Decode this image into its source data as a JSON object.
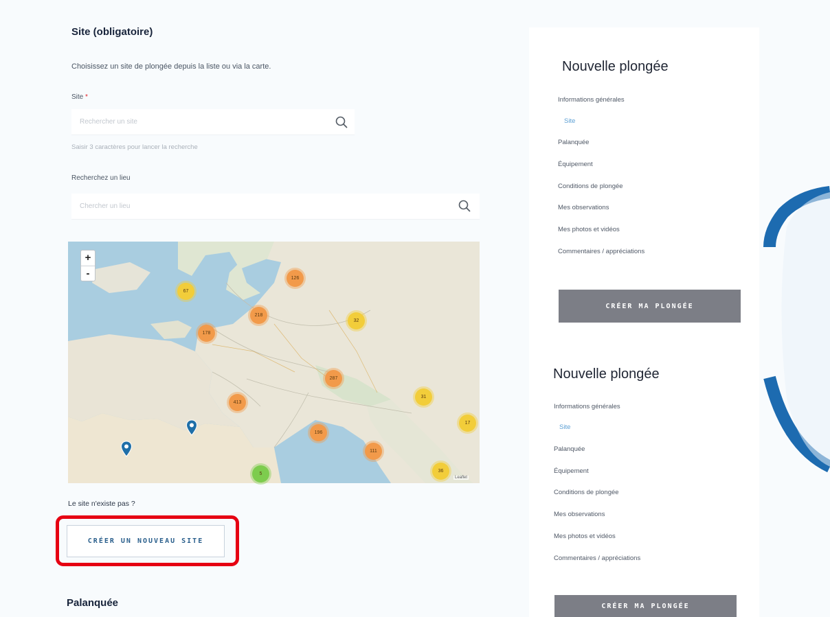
{
  "form": {
    "section_title": "Site (obligatoire)",
    "description": "Choisissez un site de plongée depuis la liste ou via la carte.",
    "site_label": "Site",
    "site_required_mark": "*",
    "site_input_placeholder": "Rechercher un site",
    "site_help": "Saisir 3 caractères pour lancer la recherche",
    "place_label": "Recherchez un lieu",
    "place_input_placeholder": "Chercher un lieu",
    "no_site_text": "Le site n'existe pas ?",
    "new_site_button": "CRÉER UN NOUVEAU SITE",
    "next_section_title": "Palanquée"
  },
  "map": {
    "zoom_in": "+",
    "zoom_out": "-",
    "attribution": "Leaflet",
    "clusters": [
      {
        "label": "67",
        "color": "yellow"
      },
      {
        "label": "126",
        "color": "orange"
      },
      {
        "label": "218",
        "color": "orange"
      },
      {
        "label": "32",
        "color": "yellow"
      },
      {
        "label": "178",
        "color": "orange"
      },
      {
        "label": "287",
        "color": "orange"
      },
      {
        "label": "31",
        "color": "yellow"
      },
      {
        "label": "413",
        "color": "orange"
      },
      {
        "label": "17",
        "color": "yellow"
      },
      {
        "label": "196",
        "color": "orange"
      },
      {
        "label": "111",
        "color": "orange"
      },
      {
        "label": "36",
        "color": "yellow"
      },
      {
        "label": "5",
        "color": "green"
      }
    ]
  },
  "sidebars": [
    {
      "title": "Nouvelle plongée",
      "items": [
        "Informations générales",
        "Site",
        "Palanquée",
        "Équipement",
        "Conditions de plongée",
        "Mes observations",
        "Mes photos et vidéos",
        "Commentaires / appréciations"
      ],
      "active_index": 1,
      "button": "CRÉER MA PLONGÉE"
    },
    {
      "title": "Nouvelle plongée",
      "items": [
        "Informations générales",
        "Site",
        "Palanquée",
        "Équipement",
        "Conditions de plongée",
        "Mes observations",
        "Mes photos et vidéos",
        "Commentaires / appréciations"
      ],
      "active_index": 1,
      "button": "CRÉER MA PLONGÉE"
    }
  ],
  "colors": {
    "accent": "#2a5f8c",
    "highlight": "#e60012",
    "button_gray": "#7c7e86",
    "active_link": "#5b9fd4"
  },
  "icons": {
    "search": "search-icon",
    "map_pin": "map-pin-icon"
  }
}
